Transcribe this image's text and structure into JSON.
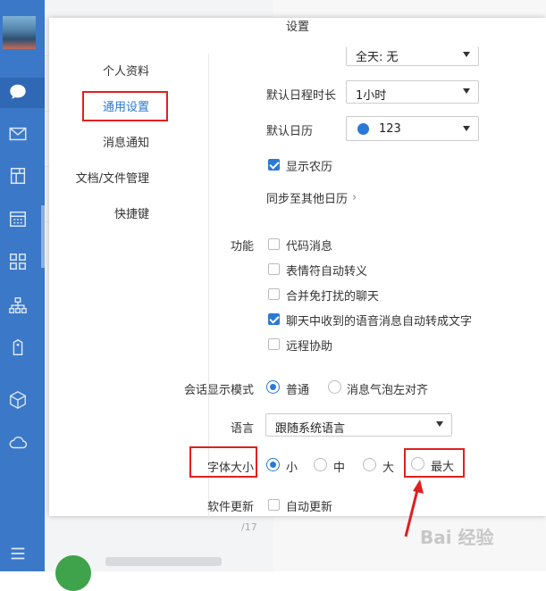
{
  "modal": {
    "title": "设置"
  },
  "nav": {
    "items": [
      {
        "label": "个人资料"
      },
      {
        "label": "通用设置"
      },
      {
        "label": "消息通知"
      },
      {
        "label": "文档/文件管理"
      },
      {
        "label": "快捷键"
      }
    ]
  },
  "general": {
    "top_select_value": "全天: 无",
    "duration_label": "默认日程时长",
    "duration_value": "1小时",
    "calendar_label": "默认日历",
    "calendar_value": "123",
    "calendar_color": "#2a79d6",
    "lunar_label": "显示农历",
    "lunar_checked": true,
    "sync_label": "同步至其他日历"
  },
  "features": {
    "label": "功能",
    "items": [
      {
        "label": "代码消息",
        "checked": false
      },
      {
        "label": "表情符自动转义",
        "checked": false
      },
      {
        "label": "合并免打扰的聊天",
        "checked": false
      },
      {
        "label": "聊天中收到的语音消息自动转成文字",
        "checked": true
      },
      {
        "label": "远程协助",
        "checked": false
      }
    ]
  },
  "display_mode": {
    "label": "会话显示模式",
    "options": [
      {
        "label": "普通",
        "checked": true
      },
      {
        "label": "消息气泡左对齐",
        "checked": false
      }
    ]
  },
  "language": {
    "label": "语言",
    "value": "跟随系统语言"
  },
  "font_size": {
    "label": "字体大小",
    "options": [
      {
        "label": "小",
        "checked": true
      },
      {
        "label": "中",
        "checked": false
      },
      {
        "label": "大",
        "checked": false
      },
      {
        "label": "最大",
        "checked": false
      }
    ]
  },
  "update": {
    "label": "软件更新",
    "option_label": "自动更新",
    "checked": false
  },
  "background": {
    "date_fragment": "/17"
  },
  "watermark": {
    "text": "Bai 经验"
  },
  "colors": {
    "sidebar": "#3b78c7",
    "accent": "#2a79d6",
    "highlight_red": "#e02020"
  }
}
